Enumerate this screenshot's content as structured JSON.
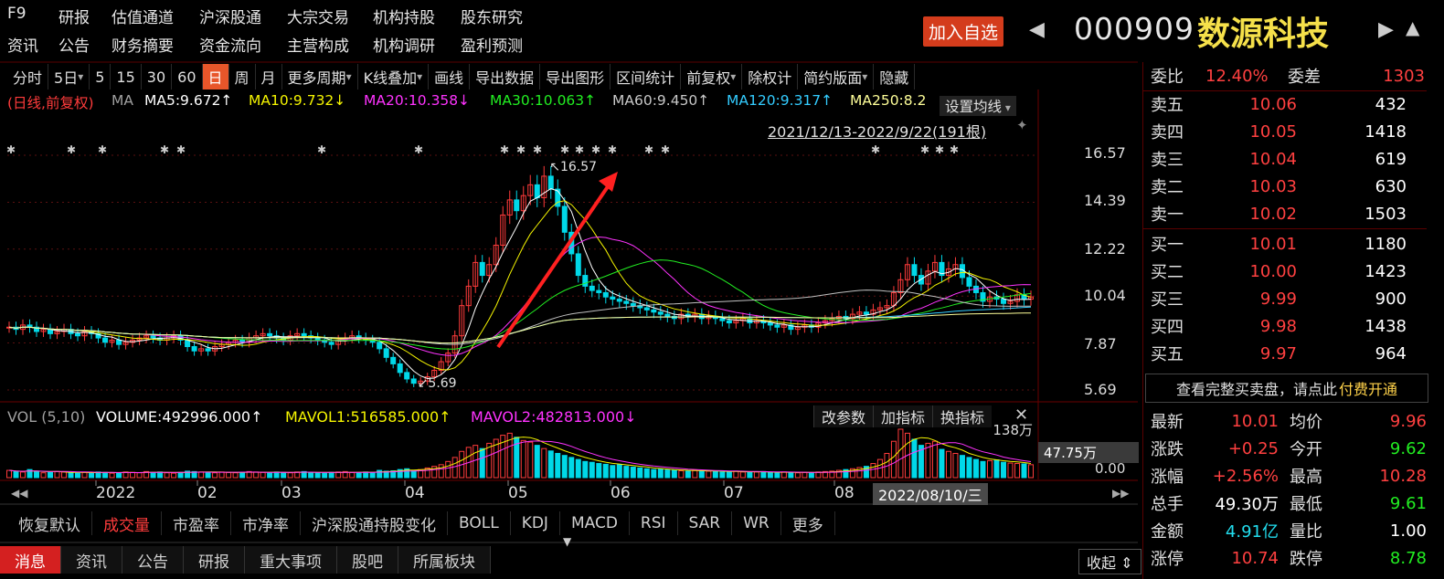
{
  "nav_top": [
    "F9",
    "研报",
    "估值通道",
    "沪深股通",
    "大宗交易",
    "机构持股",
    "股东研究"
  ],
  "nav_bottom": [
    "资讯",
    "公告",
    "财务摘要",
    "资金流向",
    "主营构成",
    "机构调研",
    "盈利预测"
  ],
  "add_watch": "加入自选",
  "stock": {
    "code": "000909",
    "name": "数源科技"
  },
  "toolbar": [
    "分时",
    "5日",
    "5",
    "15",
    "30",
    "60",
    "日",
    "周",
    "月",
    "更多周期",
    "K线叠加",
    "画线",
    "导出数据",
    "导出图形",
    "区间统计",
    "前复权",
    "除权计",
    "简约版面",
    "隐藏"
  ],
  "toolbar_active": "日",
  "ma_line": {
    "label": "(日线,前复权)",
    "ma": "MA",
    "ma5": "MA5:9.672↑",
    "ma10": "MA10:9.732↓",
    "ma20": "MA20:10.358↓",
    "ma30": "MA30:10.063↑",
    "ma60": "MA60:9.450↑",
    "ma120": "MA120:9.317↑",
    "ma250": "MA250:8.2",
    "settings": "设置均线"
  },
  "date_range": "2021/12/13-2022/9/22(191根)",
  "y_labels": [
    "16.57",
    "14.39",
    "12.22",
    "10.04",
    "7.87",
    "5.69"
  ],
  "annotations": {
    "high": "16.57",
    "low": "5.69"
  },
  "vol": {
    "label": "VOL (5,10)",
    "volume": "VOLUME:492996.000↑",
    "mavol1": "MAVOL1:516585.000↑",
    "mavol2": "MAVOL2:482813.000↓",
    "buttons": [
      "改参数",
      "加指标",
      "换指标"
    ],
    "y_top": "138万",
    "y_mid": "47.75万",
    "y_bot": "0.00"
  },
  "x_labels": [
    "2022",
    "02",
    "03",
    "04",
    "05",
    "06",
    "07",
    "08"
  ],
  "cursor_date": "2022/08/10/三",
  "indicator_tabs": [
    "恢复默认",
    "成交量",
    "市盈率",
    "市净率",
    "沪深股通持股变化",
    "BOLL",
    "KDJ",
    "MACD",
    "RSI",
    "SAR",
    "WR",
    "更多"
  ],
  "indicator_active": "成交量",
  "bottom_tabs": [
    "消息",
    "资讯",
    "公告",
    "研报",
    "重大事项",
    "股吧",
    "所属板块"
  ],
  "collapse": "收起",
  "order_book": {
    "webi_label": "委比",
    "webi": "12.40%",
    "wecha_label": "委差",
    "wecha": "1303",
    "sells": [
      {
        "label": "卖五",
        "price": "10.06",
        "vol": "432"
      },
      {
        "label": "卖四",
        "price": "10.05",
        "vol": "1418"
      },
      {
        "label": "卖三",
        "price": "10.04",
        "vol": "619"
      },
      {
        "label": "卖二",
        "price": "10.03",
        "vol": "630"
      },
      {
        "label": "卖一",
        "price": "10.02",
        "vol": "1503"
      }
    ],
    "buys": [
      {
        "label": "买一",
        "price": "10.01",
        "vol": "1180"
      },
      {
        "label": "买二",
        "price": "10.00",
        "vol": "1423"
      },
      {
        "label": "买三",
        "price": "9.99",
        "vol": "900"
      },
      {
        "label": "买四",
        "price": "9.98",
        "vol": "1438"
      },
      {
        "label": "买五",
        "price": "9.97",
        "vol": "964"
      }
    ],
    "notice": "查看完整买卖盘，请点此",
    "notice_link": "付费开通"
  },
  "quote": [
    {
      "l": "最新",
      "v": "10.01",
      "c": "red",
      "l2": "均价",
      "v2": "9.96",
      "c2": "red"
    },
    {
      "l": "涨跌",
      "v": "+0.25",
      "c": "red",
      "l2": "今开",
      "v2": "9.62",
      "c2": "green"
    },
    {
      "l": "涨幅",
      "v": "+2.56%",
      "c": "red",
      "l2": "最高",
      "v2": "10.28",
      "c2": "red"
    },
    {
      "l": "总手",
      "v": "49.30万",
      "c": "white",
      "l2": "最低",
      "v2": "9.61",
      "c2": "green"
    },
    {
      "l": "金额",
      "v": "4.91亿",
      "c": "cyan",
      "l2": "量比",
      "v2": "1.00",
      "c2": "white"
    },
    {
      "l": "涨停",
      "v": "10.74",
      "c": "red",
      "l2": "跌停",
      "v2": "8.78",
      "c2": "green"
    }
  ],
  "colors": {
    "up": "#ff3b3b",
    "down": "#00d8e8",
    "ma5": "#ffffff",
    "ma10": "#f5f500",
    "ma20": "#ff33ff",
    "ma30": "#22ee22",
    "ma60": "#c0c0c0",
    "ma120": "#33ccff",
    "ma250": "#ffff99"
  },
  "chart_data": {
    "type": "candlestick",
    "ylim": [
      5.69,
      16.57
    ],
    "x_tick_labels": [
      "2022",
      "02",
      "03",
      "04",
      "05",
      "06",
      "07",
      "08"
    ],
    "y_tick_labels": [
      "16.57",
      "14.39",
      "12.22",
      "10.04",
      "7.87",
      "5.69"
    ],
    "max_marker": 16.57,
    "min_marker": 5.69,
    "closes_approx": [
      8.6,
      8.5,
      8.7,
      8.6,
      8.4,
      8.5,
      8.3,
      8.4,
      8.5,
      8.3,
      8.2,
      8.4,
      8.3,
      8.1,
      7.9,
      8.0,
      7.8,
      7.9,
      8.0,
      8.1,
      8.2,
      8.1,
      8.0,
      8.1,
      8.2,
      8.0,
      7.7,
      7.5,
      7.6,
      7.5,
      7.7,
      7.8,
      7.9,
      8.0,
      7.9,
      8.1,
      8.2,
      8.3,
      8.2,
      8.1,
      8.0,
      8.2,
      8.3,
      8.2,
      8.1,
      8.0,
      7.9,
      7.8,
      8.0,
      8.1,
      8.2,
      8.1,
      8.0,
      7.9,
      7.6,
      7.2,
      6.9,
      6.5,
      6.2,
      6.0,
      6.1,
      6.3,
      6.6,
      7.0,
      7.4,
      8.2,
      9.6,
      10.5,
      11.6,
      11.0,
      11.5,
      12.4,
      13.8,
      14.5,
      14.0,
      14.7,
      15.2,
      14.6,
      15.6,
      15.0,
      14.2,
      13.0,
      12.0,
      11.0,
      10.5,
      10.3,
      10.2,
      10.0,
      9.9,
      9.8,
      9.7,
      9.6,
      9.5,
      9.4,
      9.3,
      9.2,
      9.1,
      9.0,
      9.2,
      9.1,
      9.2,
      9.0,
      9.1,
      9.0,
      8.9,
      8.8,
      8.9,
      9.0,
      8.8,
      8.9,
      8.8,
      8.7,
      8.6,
      8.7,
      8.5,
      8.6,
      8.7,
      8.6,
      8.8,
      8.9,
      9.0,
      9.1,
      9.0,
      9.2,
      9.3,
      9.2,
      9.4,
      9.5,
      9.6,
      10.2,
      10.8,
      11.5,
      11.0,
      10.6,
      11.2,
      11.6,
      11.0,
      11.3,
      11.5,
      10.9,
      10.5,
      10.2,
      9.8,
      10.0,
      9.9,
      9.7,
      9.8,
      10.1,
      9.9,
      10.0
    ],
    "volume_approx_wan": [
      18,
      15,
      14,
      20,
      16,
      12,
      13,
      15,
      14,
      12,
      11,
      13,
      12,
      14,
      13,
      11,
      12,
      14,
      13,
      12,
      15,
      13,
      14,
      12,
      11,
      13,
      16,
      15,
      14,
      13,
      12,
      14,
      13,
      12,
      13,
      15,
      14,
      13,
      12,
      14,
      13,
      12,
      14,
      15,
      13,
      12,
      11,
      13,
      14,
      15,
      13,
      12,
      14,
      13,
      18,
      16,
      17,
      20,
      22,
      18,
      20,
      24,
      28,
      32,
      40,
      50,
      65,
      75,
      80,
      72,
      85,
      95,
      105,
      110,
      100,
      92,
      88,
      80,
      72,
      66,
      60,
      55,
      50,
      45,
      40,
      38,
      35,
      33,
      30,
      32,
      28,
      26,
      24,
      22,
      20,
      21,
      19,
      18,
      17,
      16,
      18,
      17,
      16,
      15,
      14,
      15,
      16,
      14,
      13,
      14,
      15,
      13,
      12,
      14,
      13,
      12,
      13,
      12,
      14,
      15,
      16,
      18,
      20,
      22,
      25,
      28,
      35,
      45,
      60,
      90,
      120,
      110,
      95,
      80,
      85,
      90,
      70,
      65,
      60,
      55,
      50,
      45,
      40,
      42,
      44,
      38,
      36,
      35,
      34,
      32
    ]
  }
}
